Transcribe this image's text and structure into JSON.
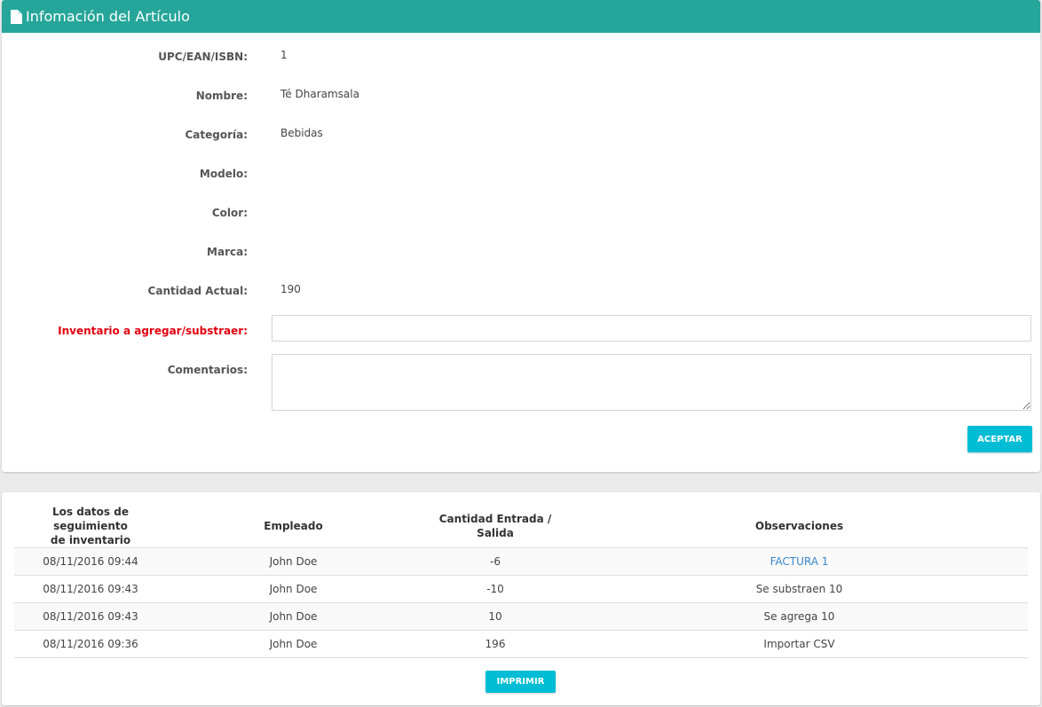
{
  "header": {
    "title": "Infomación del Artículo",
    "icon": "document-icon",
    "color": "#26a69a"
  },
  "fields": {
    "upc": {
      "label": "UPC/EAN/ISBN:",
      "value": "1"
    },
    "nombre": {
      "label": "Nombre:",
      "value": "Té Dharamsala"
    },
    "categoria": {
      "label": "Categoría:",
      "value": "Bebidas"
    },
    "modelo": {
      "label": "Modelo:",
      "value": ""
    },
    "color": {
      "label": "Color:",
      "value": ""
    },
    "marca": {
      "label": "Marca:",
      "value": ""
    },
    "cantidad": {
      "label": "Cantidad Actual:",
      "value": "190"
    },
    "inventario": {
      "label": "Inventario a agregar/substraer:",
      "value": ""
    },
    "comentarios": {
      "label": "Comentarios:",
      "value": ""
    }
  },
  "buttons": {
    "accept": "ACEPTAR",
    "print": "IMPRIMIR",
    "color": "#00bcd4"
  },
  "history": {
    "headers": {
      "date_line1": "Los datos de seguimiento",
      "date_line2": "de inventario",
      "employee": "Empleado",
      "quantity": "Cantidad Entrada / Salida",
      "notes": "Observaciones"
    },
    "rows": [
      {
        "date": "08/11/2016 09:44",
        "employee": "John Doe",
        "quantity": "-6",
        "notes": "FACTURA 1",
        "link": true
      },
      {
        "date": "08/11/2016 09:43",
        "employee": "John Doe",
        "quantity": "-10",
        "notes": "Se substraen 10",
        "link": false
      },
      {
        "date": "08/11/2016 09:43",
        "employee": "John Doe",
        "quantity": "10",
        "notes": "Se agrega 10",
        "link": false
      },
      {
        "date": "08/11/2016 09:36",
        "employee": "John Doe",
        "quantity": "196",
        "notes": "Importar CSV",
        "link": false
      }
    ]
  }
}
